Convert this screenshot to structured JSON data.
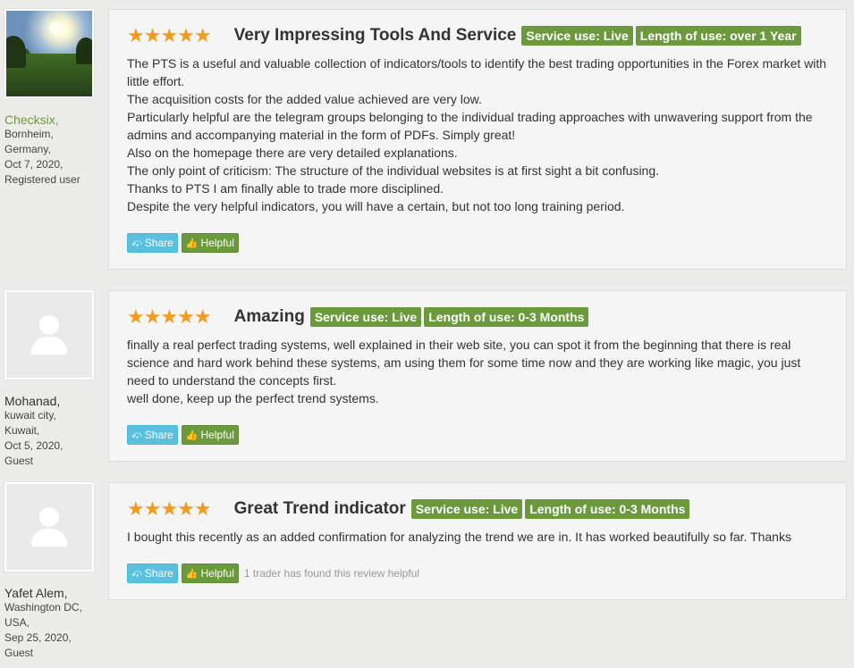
{
  "reviews": [
    {
      "user": {
        "name": "Checksix,",
        "location1": "Bornheim,",
        "location2": "Germany,",
        "date": "Oct 7, 2020,",
        "type": "Registered user"
      },
      "stars": "★★★★★",
      "title": "Very Impressing Tools And Service",
      "badge_service": "Service use: Live",
      "badge_length": "Length of use: over 1 Year",
      "paragraphs": [
        "The PTS is a useful and valuable collection of indicators/tools to identify the best trading opportunities in the Forex market with little effort.",
        "The acquisition costs for the added value achieved are very low.",
        "Particularly helpful are the telegram groups belonging to the individual trading approaches with unwavering support from the admins and accompanying material in the form of PDFs. Simply great!",
        "Also on the homepage there are very detailed explanations.",
        "The only point of criticism: The structure of the individual websites is at first sight a bit confusing.",
        "Thanks to PTS I am finally able to trade more disciplined.",
        "Despite the very helpful indicators, you will have a certain, but not too long training period."
      ],
      "share_label": "Share",
      "helpful_label": "Helpful",
      "helpful_note": ""
    },
    {
      "user": {
        "name": "Mohanad,",
        "location1": "kuwait city,",
        "location2": "Kuwait,",
        "date": "Oct 5, 2020,",
        "type": "Guest"
      },
      "stars": "★★★★★",
      "title": "Amazing",
      "badge_service": "Service use: Live",
      "badge_length": "Length of use: 0-3 Months",
      "paragraphs": [
        "finally a real perfect trading systems, well explained in their web site, you can spot it from the beginning that there is real science and hard work behind these systems, am using them for some time now and they are working like magic, you just need to understand the concepts first.",
        "well done, keep up the perfect trend systems."
      ],
      "share_label": "Share",
      "helpful_label": "Helpful",
      "helpful_note": ""
    },
    {
      "user": {
        "name": "Yafet Alem,",
        "location1": "Washington DC,",
        "location2": "USA,",
        "date": "Sep 25, 2020,",
        "type": "Guest"
      },
      "stars": "★★★★★",
      "title": "Great Trend indicator",
      "badge_service": "Service use: Live",
      "badge_length": "Length of use: 0-3 Months",
      "paragraphs": [
        "I bought this recently as an added confirmation for analyzing the trend we are in. It has worked beautifully so far. Thanks"
      ],
      "share_label": "Share",
      "helpful_label": "Helpful",
      "helpful_note": "1 trader has found this review helpful"
    }
  ],
  "icons": {
    "share": "share-icon",
    "helpful": "thumbs-up-icon",
    "avatar": "user-silhouette-icon"
  },
  "colors": {
    "badge_green": "#6a9a3b",
    "star_orange": "#f39b1f",
    "share_blue": "#5bc0de",
    "username_green": "#6d9a3b"
  }
}
